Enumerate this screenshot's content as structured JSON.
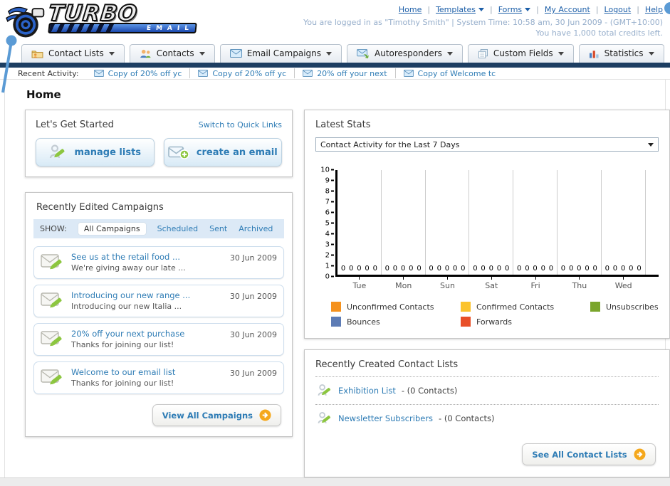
{
  "header": {
    "logo": {
      "title": "TURBO",
      "subtitle": "EMAIL"
    },
    "nav": [
      {
        "label": "Home",
        "dropdown": false
      },
      {
        "label": "Templates",
        "dropdown": true
      },
      {
        "label": "Forms",
        "dropdown": true
      },
      {
        "label": "My Account",
        "dropdown": false
      },
      {
        "label": "Logout",
        "dropdown": false
      },
      {
        "label": "Help",
        "dropdown": false
      }
    ],
    "login_line1": "You are logged in as \"Timothy Smith\" | System Time: 10:58 am, 30 Jun 2009 - (GMT+10:00)",
    "login_line2": "You have 1,000 total credits left."
  },
  "main_nav": {
    "tabs": [
      {
        "label": "Contact Lists",
        "icon": "contact-lists-folder-icon"
      },
      {
        "label": "Contacts",
        "icon": "contacts-people-icon"
      },
      {
        "label": "Email Campaigns",
        "icon": "envelope-icon"
      },
      {
        "label": "Autoresponders",
        "icon": "autoresponder-envelope-icon"
      },
      {
        "label": "Custom Fields",
        "icon": "pages-icon"
      },
      {
        "label": "Statistics",
        "icon": "bar-chart-icon"
      }
    ]
  },
  "recent_activity": {
    "label": "Recent Activity:",
    "items": [
      "Copy of 20% off yc",
      "Copy of 20% off yc",
      "20% off your next",
      "Copy of Welcome tc"
    ]
  },
  "page_title": "Home",
  "get_started": {
    "title": "Let's Get Started",
    "switch_link": "Switch to Quick Links",
    "buttons": [
      {
        "label": "manage lists"
      },
      {
        "label": "create an email"
      }
    ]
  },
  "campaigns": {
    "title": "Recently Edited Campaigns",
    "show_label": "SHOW:",
    "filters": [
      "All Campaigns",
      "Scheduled",
      "Sent",
      "Archived"
    ],
    "active_filter": "All Campaigns",
    "items": [
      {
        "title": "See us at the retail food ...",
        "subtitle": "We're giving away our late ...",
        "date": "30 Jun 2009"
      },
      {
        "title": "Introducing our new range ...",
        "subtitle": "Introducing our new Italia ...",
        "date": "30 Jun 2009"
      },
      {
        "title": "20% off your next purchase",
        "subtitle": "Thanks for joining our list!",
        "date": "30 Jun 2009"
      },
      {
        "title": "Welcome to our email list",
        "subtitle": "Thanks for joining our list!",
        "date": "30 Jun 2009"
      }
    ],
    "view_all_label": "View All Campaigns"
  },
  "stats": {
    "title": "Latest Stats",
    "dropdown_value": "Contact Activity for the Last 7 Days",
    "chart_data": {
      "type": "bar",
      "categories": [
        "Tue",
        "Mon",
        "Sun",
        "Sat",
        "Fri",
        "Thu",
        "Wed"
      ],
      "series": [
        {
          "name": "Unconfirmed Contacts",
          "color": "#f5921e",
          "values": [
            0,
            0,
            0,
            0,
            0,
            0,
            0
          ]
        },
        {
          "name": "Confirmed Contacts",
          "color": "#fbc32d",
          "values": [
            0,
            0,
            0,
            0,
            0,
            0,
            0
          ]
        },
        {
          "name": "Unsubscribes",
          "color": "#7aa52c",
          "values": [
            0,
            0,
            0,
            0,
            0,
            0,
            0
          ]
        },
        {
          "name": "Bounces",
          "color": "#5d7cb5",
          "values": [
            0,
            0,
            0,
            0,
            0,
            0,
            0
          ]
        },
        {
          "name": "Forwards",
          "color": "#e84f28",
          "values": [
            0,
            0,
            0,
            0,
            0,
            0,
            0
          ]
        }
      ],
      "title": "Contact Activity for the Last 7 Days",
      "xlabel": "",
      "ylabel": "",
      "ylim": [
        0,
        10
      ],
      "ytick_step": 1,
      "grid": "vertical",
      "legend_position": "bottom"
    }
  },
  "contact_lists": {
    "title": "Recently Created Contact Lists",
    "items": [
      {
        "name": "Exhibition List",
        "detail": "- (0 Contacts)"
      },
      {
        "name": "Newsletter Subscribers",
        "detail": "- (0 Contacts)"
      }
    ],
    "see_all_label": "See All Contact Lists"
  },
  "colors": {
    "navy_bar": "#1d3e62",
    "accent_link": "#2e7cb5",
    "top_link": "#1d5fa8",
    "orange_arrow": "#f5a81c",
    "green_pencil": "#8cc63f",
    "marker_blue": "#5b9bd5"
  }
}
